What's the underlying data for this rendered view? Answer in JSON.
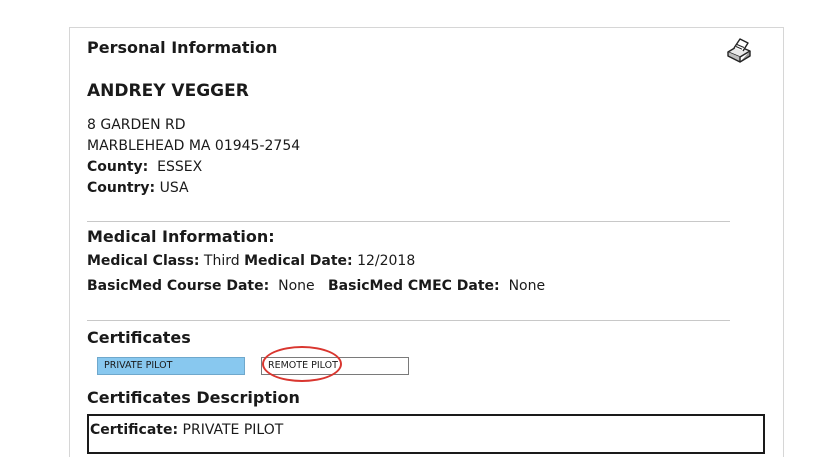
{
  "personal": {
    "heading": "Personal Information",
    "name": "ANDREY VEGGER",
    "address_line1": "8 GARDEN RD",
    "address_line2": "MARBLEHEAD MA 01945-2754",
    "county_label": "County:",
    "county_value": "ESSEX",
    "country_label": "Country:",
    "country_value": "USA"
  },
  "medical": {
    "heading": "Medical Information:",
    "class_label": "Medical Class:",
    "class_value": "Third",
    "date_label": "Medical Date:",
    "date_value": "12/2018",
    "basicmed_course_label": "BasicMed Course Date:",
    "basicmed_course_value": "None",
    "basicmed_cmec_label": "BasicMed CMEC Date:",
    "basicmed_cmec_value": "None"
  },
  "certificates": {
    "heading": "Certificates",
    "tabs": [
      "PRIVATE PILOT",
      "REMOTE PILOT"
    ],
    "description_heading": "Certificates Description",
    "description_label": "Certificate:",
    "description_value": "PRIVATE PILOT"
  },
  "icons": {
    "print": "printer-icon"
  },
  "colors": {
    "selected_tab": "#88c8ef",
    "annotation_circle": "#d9362f"
  }
}
